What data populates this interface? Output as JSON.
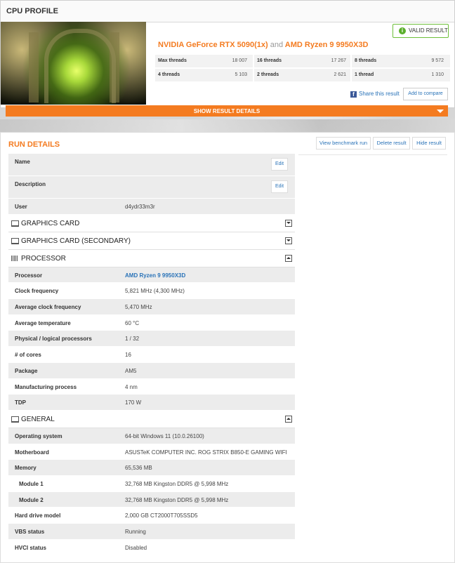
{
  "header": {
    "title": "CPU PROFILE",
    "valid_label": "VALID RESULT"
  },
  "result": {
    "gpu": "NVIDIA GeForce RTX 5090(1x)",
    "and": "and",
    "cpu": "AMD Ryzen 9 9950X3D"
  },
  "scores": [
    [
      {
        "label": "Max threads",
        "value": "18 007"
      },
      {
        "label": "16 threads",
        "value": "17 267"
      },
      {
        "label": "8 threads",
        "value": "9 572"
      }
    ],
    [
      {
        "label": "4 threads",
        "value": "5 103"
      },
      {
        "label": "2 threads",
        "value": "2 621"
      },
      {
        "label": "1 thread",
        "value": "1 310"
      }
    ]
  ],
  "actions": {
    "share": "Share this result",
    "compare": "Add to compare",
    "show_details": "SHOW RESULT DETAILS"
  },
  "run": {
    "title": "RUN DETAILS",
    "buttons": {
      "view": "View benchmark run",
      "delete": "Delete result",
      "hide": "Hide result"
    },
    "edit_label": "Edit",
    "name_label": "Name",
    "description_label": "Description",
    "user_label": "User",
    "user_value": "d4ydr33m3r"
  },
  "sections": {
    "graphics": "GRAPHICS CARD",
    "graphics_secondary": "GRAPHICS CARD (SECONDARY)",
    "processor": "PROCESSOR",
    "general": "GENERAL"
  },
  "processor": [
    {
      "k": "Processor",
      "v": "AMD Ryzen 9 9950X3D"
    },
    {
      "k": "Clock frequency",
      "v": "5,821 MHz (4,300 MHz)"
    },
    {
      "k": "Average clock frequency",
      "v": "5,470 MHz"
    },
    {
      "k": "Average temperature",
      "v": "60 °C"
    },
    {
      "k": "Physical / logical processors",
      "v": "1 / 32"
    },
    {
      "k": "# of cores",
      "v": "16"
    },
    {
      "k": "Package",
      "v": "AM5"
    },
    {
      "k": "Manufacturing process",
      "v": "4 nm"
    },
    {
      "k": "TDP",
      "v": "170 W"
    }
  ],
  "general": [
    {
      "k": "Operating system",
      "v": "64-bit Windows 11 (10.0.26100)"
    },
    {
      "k": "Motherboard",
      "v": "ASUSTeK COMPUTER INC. ROG STRIX B850-E GAMING WIFI"
    },
    {
      "k": "Memory",
      "v": "65,536 MB"
    },
    {
      "k": "Module 1",
      "v": "32,768 MB Kingston DDR5 @ 5,998 MHz"
    },
    {
      "k": "Module 2",
      "v": "32,768 MB Kingston DDR5 @ 5,998 MHz"
    },
    {
      "k": "Hard drive model",
      "v": "2,000 GB CT2000T705SSD5"
    },
    {
      "k": "VBS status",
      "v": "Running"
    },
    {
      "k": "HVCI status",
      "v": "Disabled"
    }
  ]
}
